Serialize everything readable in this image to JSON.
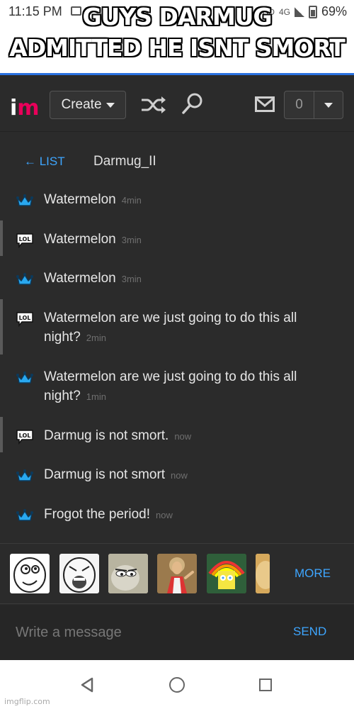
{
  "status_bar": {
    "time": "11:15 PM",
    "network": "4G",
    "hd": "HD",
    "battery": "69%"
  },
  "meme_caption": {
    "line1": "GUYS DARMUG",
    "line2": "ADMITTED HE ISNT SMORT"
  },
  "header": {
    "logo": "im",
    "create_label": "Create",
    "notification_count": "0"
  },
  "chat": {
    "back_label": "← LIST",
    "username": "Darmug_II",
    "messages": [
      {
        "icon": "crown-icon",
        "text": "Watermelon",
        "time": "4min",
        "bar": false
      },
      {
        "icon": "lol-icon",
        "text": "Watermelon",
        "time": "3min",
        "bar": true
      },
      {
        "icon": "crown-icon",
        "text": "Watermelon",
        "time": "3min",
        "bar": false
      },
      {
        "icon": "lol-icon",
        "text": "Watermelon are we just going to do this all night?",
        "time": "2min",
        "bar": true
      },
      {
        "icon": "crown-icon",
        "text": "Watermelon are we just going to do this all night?",
        "time": "1min",
        "bar": false
      },
      {
        "icon": "lol-icon",
        "text": "Darmug is not smort.",
        "time": "now",
        "bar": true
      },
      {
        "icon": "crown-icon",
        "text": "Darmug is not smort",
        "time": "now",
        "bar": false
      },
      {
        "icon": "crown-icon",
        "text": "Frogot the period!",
        "time": "now",
        "bar": false
      }
    ]
  },
  "meme_bar": {
    "thumbs": [
      "rage-face-thumb",
      "lol-face-thumb",
      "tom-cat-thumb",
      "buddy-christ-thumb",
      "imagination-spongebob-thumb",
      "doge-thumb"
    ],
    "more_label": "MORE"
  },
  "composer": {
    "placeholder": "Write a message",
    "send_label": "SEND"
  },
  "watermark": "imgflip.com",
  "colors": {
    "accent": "#3ea6ff",
    "brand": "#e8005a",
    "crown": "#29a8f0",
    "background": "#2b2b2b"
  }
}
